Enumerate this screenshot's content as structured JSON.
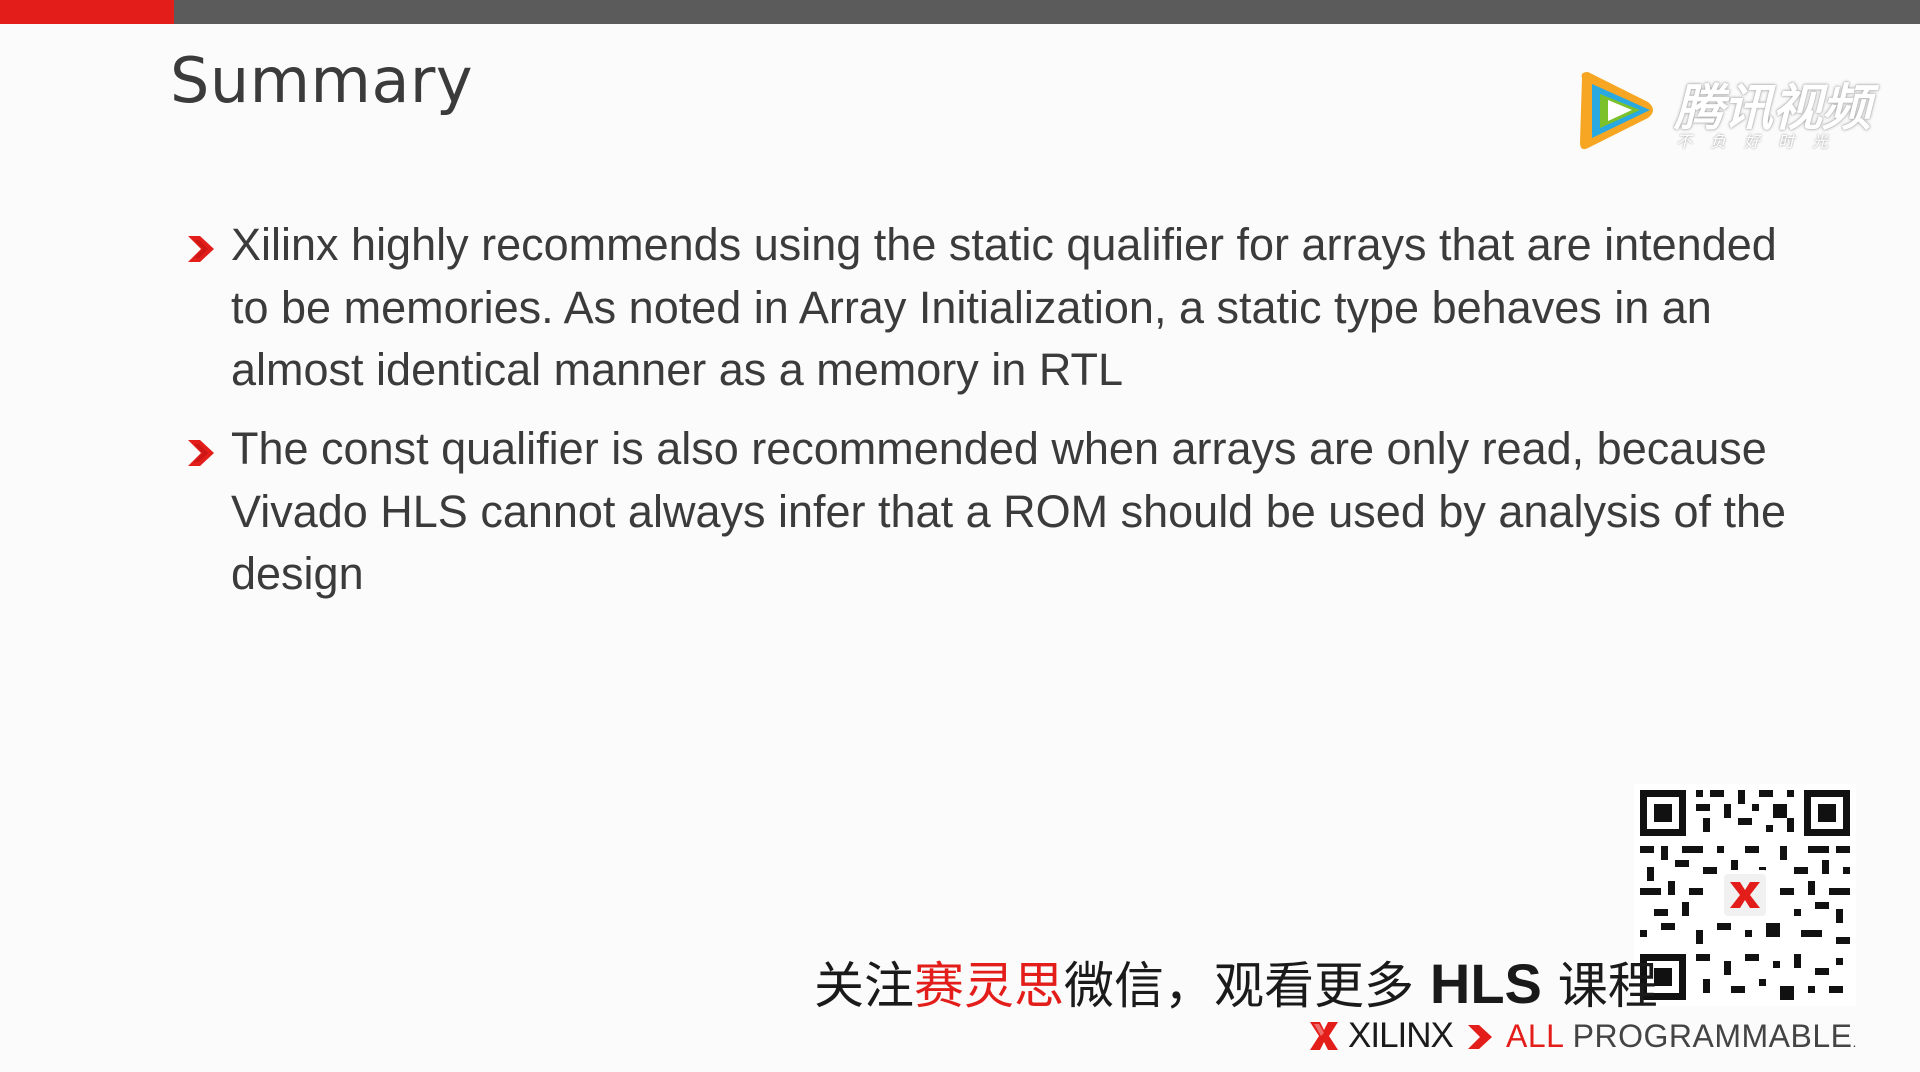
{
  "slide": {
    "title": "Summary",
    "bullets": [
      "Xilinx highly recommends using the static qualifier for arrays that are intended to be memories. As noted in Array Initialization, a static type behaves in an almost identical manner as a memory in RTL",
      "The const qualifier is also recommended when arrays are only read, because Vivado HLS cannot always infer that a ROM should be used by analysis of the design"
    ]
  },
  "overlay": {
    "tencent_video_name": "腾讯视频",
    "tencent_video_slogan": "不负好时光"
  },
  "promo": {
    "part1": "关注",
    "part2": "赛灵思",
    "part3": "微信，观看更多 ",
    "part4": "HLS",
    "part5": " 课程"
  },
  "footer": {
    "brand": "XILINX",
    "tagline_all": "ALL",
    "tagline_rest": " PROGRAMMABLE",
    "tm": "."
  },
  "colors": {
    "accent_red": "#e31d1a",
    "top_bar_gray": "#5b5b5b",
    "text_dark": "#3b3b3b",
    "background": "#fbfbfb"
  },
  "icons": {
    "bullet": "red-chevron-icon",
    "tencent": "tencent-video-play-logo",
    "xilinx": "xilinx-x-logo",
    "qr": "qr-code"
  }
}
